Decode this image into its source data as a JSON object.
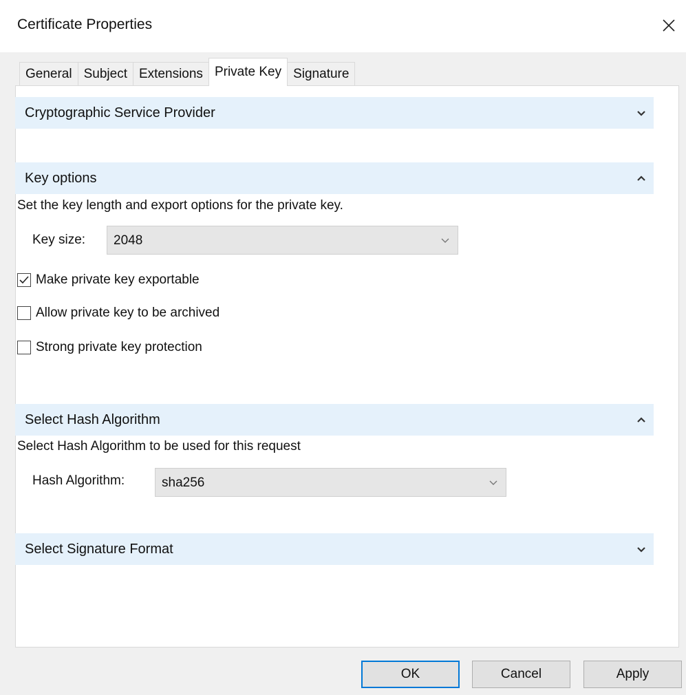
{
  "window": {
    "title": "Certificate Properties",
    "close_glyph": "✕"
  },
  "tabs": [
    {
      "label": "General",
      "active": false
    },
    {
      "label": "Subject",
      "active": false
    },
    {
      "label": "Extensions",
      "active": false
    },
    {
      "label": "Private Key",
      "active": true
    },
    {
      "label": "Signature",
      "active": false
    }
  ],
  "sections": {
    "csp": {
      "title": "Cryptographic Service Provider",
      "expanded": false,
      "icon": "chevron-down-icon"
    },
    "key_options": {
      "title": "Key options",
      "expanded": true,
      "icon": "chevron-up-icon",
      "description": "Set the key length and export options for the private key.",
      "key_size_label": "Key size:",
      "key_size_value": "2048",
      "checkboxes": [
        {
          "label": "Make private key exportable",
          "checked": true
        },
        {
          "label": "Allow private key to be archived",
          "checked": false
        },
        {
          "label": "Strong private key protection",
          "checked": false
        }
      ]
    },
    "hash": {
      "title": "Select Hash Algorithm",
      "expanded": true,
      "icon": "chevron-up-icon",
      "description": "Select Hash Algorithm to be used for this request",
      "label": "Hash Algorithm:",
      "value": "sha256"
    },
    "signature_format": {
      "title": "Select Signature Format",
      "expanded": false,
      "icon": "chevron-down-icon"
    }
  },
  "buttons": {
    "ok": "OK",
    "cancel": "Cancel",
    "apply": "Apply"
  },
  "colors": {
    "section_header_bg": "#e5f1fb",
    "default_button_border": "#0078d7",
    "dialog_bg": "#f0f0f0"
  }
}
